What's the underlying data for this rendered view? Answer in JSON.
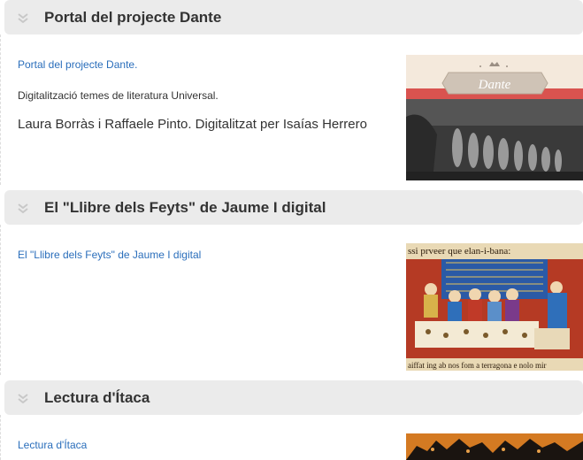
{
  "sections": [
    {
      "title": "Portal del projecte Dante",
      "link": "Portal del projecte Dante.",
      "description": "Digitalització temes de literatura Universal.",
      "credit": "Laura Borràs i Raffaele Pinto. Digitalitzat per Isaías Herrero",
      "image_text": "Dante"
    },
    {
      "title": "El \"Llibre dels Feyts\" de Jaume I digital",
      "link": "El \"Llibre dels Feyts\" de Jaume I digital",
      "image_top_text": "ssi prveer que elan-i-bana:",
      "image_bottom_text": "aiffat ing ab nos fom a terragona e nolo mir"
    },
    {
      "title": "Lectura d'Ítaca",
      "link": "Lectura d'Ítaca"
    }
  ],
  "colors": {
    "header_bg": "#ebebeb",
    "link": "#2a6ebb",
    "title": "#333333",
    "chevron": "#c8c8c8"
  }
}
